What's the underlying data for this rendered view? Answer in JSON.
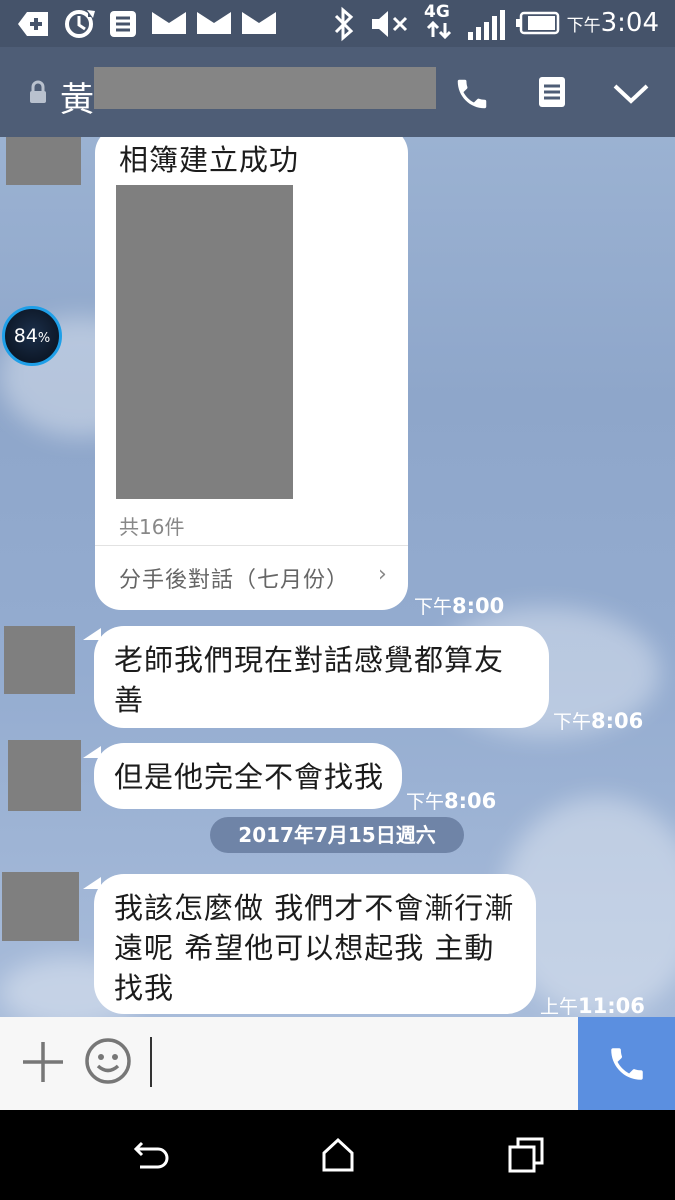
{
  "status_bar": {
    "clock_ampm": "下午",
    "clock_time": "3:04",
    "network_label": "4G",
    "notification_icons": [
      "add-box-icon",
      "sync-icon",
      "document-icon",
      "mail-icon",
      "mail-icon",
      "mail-icon"
    ],
    "system_icons": [
      "bluetooth-icon",
      "volume-mute-icon",
      "4g-icon",
      "signal-icon",
      "battery-icon"
    ]
  },
  "header": {
    "chat_name": "黃",
    "icons": [
      "lock-icon",
      "phone-icon",
      "notes-icon",
      "chevron-down-icon"
    ]
  },
  "floating_widget": {
    "battery_value": "84",
    "battery_unit": "%"
  },
  "messages": [
    {
      "type": "album",
      "title": "相簿建立成功",
      "count_label": "共16件",
      "album_link": "分手後對話（七月份）",
      "chevron": "›",
      "time_ampm": "下午",
      "time": "8:00"
    },
    {
      "type": "text",
      "line1": "老師我們現在對話感覺都算友",
      "line2": "善",
      "time_ampm": "下午",
      "time": "8:06"
    },
    {
      "type": "text",
      "line1": "但是他完全不會找我",
      "time_ampm": "下午",
      "time": "8:06"
    },
    {
      "type": "date",
      "label": "2017年7月15日週六"
    },
    {
      "type": "text",
      "line1": "我該怎麼做 我們才不會漸行漸",
      "line2": "遠呢 希望他可以想起我 主動",
      "line3": "找我",
      "time_ampm": "上午",
      "time": "11:06"
    }
  ],
  "input_bar": {
    "text_value": "",
    "icons": [
      "plus-icon",
      "emoji-icon",
      "phone-icon"
    ]
  },
  "colors": {
    "status_bar": "#45536a",
    "header": "#4e5d76",
    "chat_background": "#94acd0",
    "call_button": "#5b8fe0"
  }
}
